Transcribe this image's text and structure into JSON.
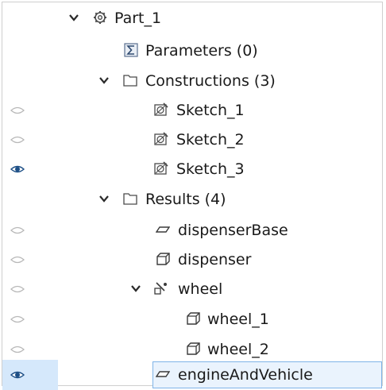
{
  "tree": {
    "part": {
      "label": "Part_1",
      "expanded": true,
      "icon": "gear-icon"
    },
    "parameters": {
      "label": "Parameters (0)",
      "icon": "sigma-icon"
    },
    "constructions": {
      "label": "Constructions (3)",
      "expanded": true,
      "icon": "folder-icon",
      "items": [
        {
          "label": "Sketch_1",
          "icon": "sketch-icon",
          "visible": false
        },
        {
          "label": "Sketch_2",
          "icon": "sketch-icon",
          "visible": false
        },
        {
          "label": "Sketch_3",
          "icon": "sketch-icon",
          "visible": true
        }
      ]
    },
    "results": {
      "label": "Results (4)",
      "expanded": true,
      "icon": "folder-icon",
      "items": [
        {
          "label": "dispenserBase",
          "icon": "face-icon",
          "visible": false
        },
        {
          "label": "dispenser",
          "icon": "solid-icon",
          "visible": false
        },
        {
          "label": "wheel",
          "icon": "compsolid-icon",
          "visible": false,
          "expanded": true,
          "children": [
            {
              "label": "wheel_1",
              "icon": "solid-icon",
              "visible": false
            },
            {
              "label": "wheel_2",
              "icon": "solid-icon",
              "visible": false
            }
          ]
        },
        {
          "label": "engineAndVehicle",
          "icon": "face-icon",
          "visible": true,
          "selected": true
        }
      ]
    }
  },
  "colors": {
    "selection_fill": "#eaf3fd",
    "selection_border": "#7fb4e8",
    "visibility_highlight": "#d5e8fb",
    "eye_visible": "#1d4f86",
    "eye_hidden": "#b8b8b8"
  }
}
